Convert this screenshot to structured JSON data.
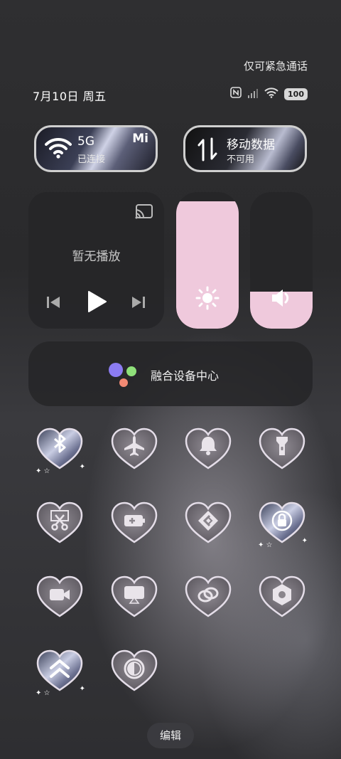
{
  "status": {
    "emergency_text": "仅可紧急通话",
    "date_text": "7月10日 周五",
    "battery_level": "100",
    "nfc_icon": "nfc-icon",
    "signal_icon": "signal-bars-icon",
    "wifi_icon": "wifi-icon"
  },
  "wifi_pill": {
    "main": "5G",
    "sub": "已连接",
    "badge": "Mi"
  },
  "data_pill": {
    "main": "移动数据",
    "sub": "不可用"
  },
  "media": {
    "title": "暂无播放"
  },
  "sliders": {
    "brightness_level": 0.93,
    "volume_level": 0.27
  },
  "hub": {
    "label": "融合设备中心"
  },
  "toggles": [
    {
      "name": "bluetooth",
      "icon": "bluetooth-icon",
      "active": true
    },
    {
      "name": "airplane-mode",
      "icon": "airplane-icon",
      "active": false
    },
    {
      "name": "silent",
      "icon": "bell-icon",
      "active": false
    },
    {
      "name": "flashlight",
      "icon": "flashlight-icon",
      "active": false
    },
    {
      "name": "screenshot",
      "icon": "scissors-icon",
      "active": false
    },
    {
      "name": "battery-saver",
      "icon": "battery-plus-icon",
      "active": false
    },
    {
      "name": "cast",
      "icon": "diamond-link-icon",
      "active": false
    },
    {
      "name": "rotation-lock",
      "icon": "rotation-lock-icon",
      "active": true
    },
    {
      "name": "screen-record",
      "icon": "video-camera-icon",
      "active": false
    },
    {
      "name": "screen-cast",
      "icon": "airplay-icon",
      "active": false
    },
    {
      "name": "hotspot",
      "icon": "link-rings-icon",
      "active": false
    },
    {
      "name": "settings",
      "icon": "gear-icon",
      "active": false
    },
    {
      "name": "data-saver",
      "icon": "double-chevron-up-icon",
      "active": true
    },
    {
      "name": "dark-mode",
      "icon": "contrast-icon",
      "active": false
    }
  ],
  "edit_label": "编辑",
  "colors": {
    "accent_pink": "#efc9dc",
    "tile_bg": "#262628"
  }
}
